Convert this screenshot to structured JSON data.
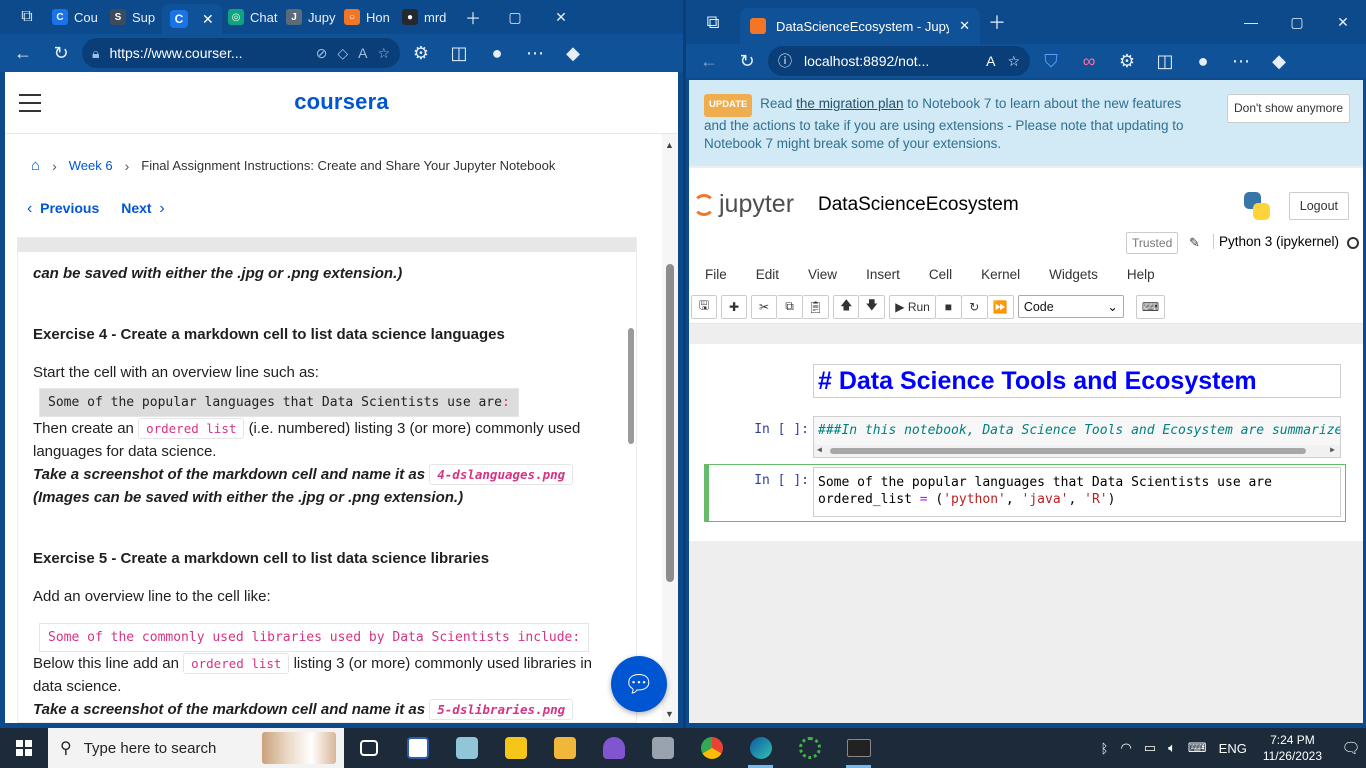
{
  "left_window": {
    "tabs": [
      {
        "label": "Cou",
        "color": "#1a73e8",
        "glyph": "C"
      },
      {
        "label": "Sup",
        "color": "#3d4b5c",
        "glyph": "S"
      },
      {
        "label": "Chat",
        "color": "#10a37f",
        "glyph": "◎"
      },
      {
        "label": "Jupy",
        "color": "#5c6b7a",
        "glyph": "J"
      },
      {
        "label": "Hon",
        "color": "#f37626",
        "glyph": "○"
      },
      {
        "label": "mrd",
        "color": "#24292f",
        "glyph": "●"
      }
    ],
    "active_tab_glyph": "C",
    "url": "https://www.courser...",
    "logo": "coursera",
    "breadcrumb": {
      "week": "Week 6",
      "current": "Final Assignment Instructions: Create and Share Your Jupyter Notebook"
    },
    "nav": {
      "previous": "Previous",
      "next": "Next"
    },
    "content": {
      "intro_tail": "can be saved with either the .jpg or .png extension.)",
      "ex4_heading": "Exercise 4 - Create a markdown cell to list data science languages",
      "ex4_start": "Start the cell with an overview line such as:",
      "ex4_code_sel": "Some of the popular languages that Data Scientists use are",
      "ex4_code_tail": ":",
      "ex4_then_1": "Then create an",
      "ex4_ordered": "ordered list",
      "ex4_then_2": "(i.e. numbered) listing 3 (or more) commonly used languages for data science.",
      "ex4_shot": "Take a screenshot of the markdown cell and name it as",
      "ex4_file": "4-dslanguages.png",
      "ex4_ext": "(Images can be saved with either the .jpg or .png extension.)",
      "ex5_heading": "Exercise 5 - Create a markdown cell to list data science libraries",
      "ex5_add": "Add an overview line to the cell like:",
      "ex5_code": "Some of the commonly used libraries used by Data Scientists include:",
      "ex5_below_1": "Below this line add an",
      "ex5_ordered": "ordered list",
      "ex5_below_2": "listing 3 (or more) commonly used libraries in data science.",
      "ex5_shot": "Take a screenshot of the markdown cell and name it as",
      "ex5_file": "5-dslibraries.png"
    }
  },
  "right_window": {
    "tab_title": "DataScienceEcosystem - Jupyter",
    "url": "localhost:8892/not...",
    "banner": {
      "badge": "UPDATE",
      "text_1": "Read",
      "link": "the migration plan",
      "text_2": "to Notebook 7 to learn about the new features and the actions to take if you are using extensions - Please note that updating to Notebook 7 might break some of your extensions.",
      "dismiss": "Don't show anymore"
    },
    "jupyter_logo": "jupyter",
    "notebook_name": "DataScienceEcosystem",
    "logout": "Logout",
    "trusted": "Trusted",
    "kernel": "Python 3 (ipykernel)",
    "menu": [
      "File",
      "Edit",
      "View",
      "Insert",
      "Cell",
      "Kernel",
      "Widgets",
      "Help"
    ],
    "run_label": "Run",
    "cell_type": "Code",
    "cells": [
      {
        "prompt": "",
        "text": "# Data Science Tools and Ecosystem"
      },
      {
        "prompt": "In [ ]:",
        "text": "###In this notebook, Data Science Tools and Ecosystem are summarized"
      },
      {
        "prompt": "In [ ]:",
        "line1": "Some of the popular languages that Data Scientists use are",
        "line2_a": "ordered_list ",
        "line2_op": "=",
        "line2_b": " (",
        "s1": "'python'",
        "c1": ", ",
        "s2": "'java'",
        "c2": ", ",
        "s3": "'R'",
        "line2_end": ")"
      }
    ]
  },
  "taskbar": {
    "search_placeholder": "Type here to search",
    "language": "ENG",
    "time": "7:24 PM",
    "date": "11/26/2023"
  }
}
